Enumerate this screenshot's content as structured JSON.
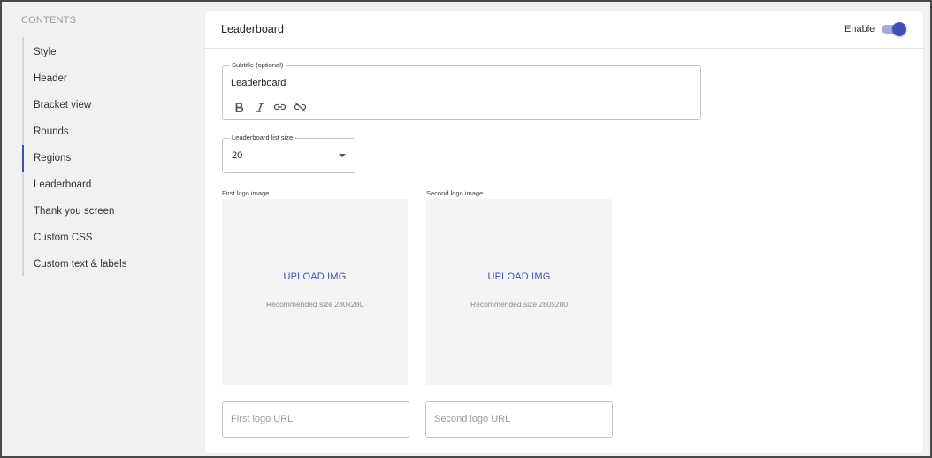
{
  "sidebar": {
    "heading": "CONTENTS",
    "items": [
      {
        "label": "Style"
      },
      {
        "label": "Header"
      },
      {
        "label": "Bracket view"
      },
      {
        "label": "Rounds"
      },
      {
        "label": "Regions",
        "active": true
      },
      {
        "label": "Leaderboard"
      },
      {
        "label": "Thank you screen"
      },
      {
        "label": "Custom CSS"
      },
      {
        "label": "Custom text & labels"
      }
    ]
  },
  "panel": {
    "title": "Leaderboard",
    "enable_label": "Enable",
    "enabled": true,
    "subtitle": {
      "label": "Subtitle (optional)",
      "value": "Leaderboard",
      "toolbar": [
        "bold-icon",
        "italic-icon",
        "link-icon",
        "unlink-icon"
      ]
    },
    "list_size": {
      "label": "Leaderboard list size",
      "value": "20"
    },
    "logos": [
      {
        "caption": "First logo image",
        "upload_label": "UPLOAD IMG",
        "hint": "Recommended size 280x280",
        "url_placeholder": "First logo URL"
      },
      {
        "caption": "Second logo image",
        "upload_label": "UPLOAD IMG",
        "hint": "Recommended size 280x280",
        "url_placeholder": "Second logo URL"
      }
    ]
  },
  "colors": {
    "accent": "#3f51b5",
    "toggle_track": "#a3acd9",
    "background": "#f1f1f1"
  }
}
